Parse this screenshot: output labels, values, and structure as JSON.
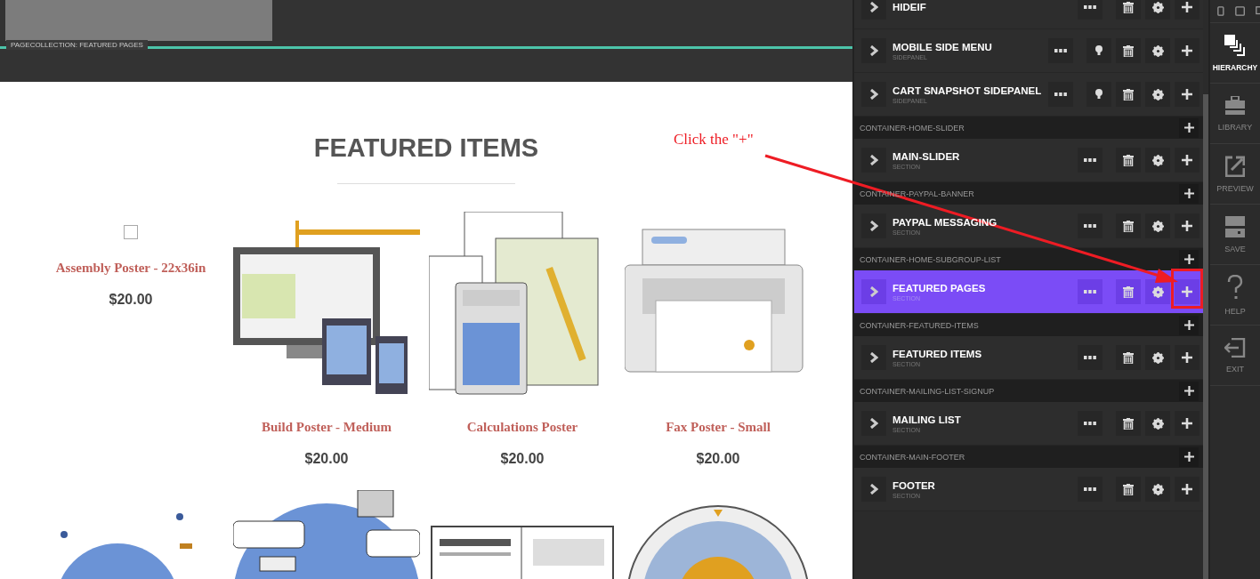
{
  "preview": {
    "collection_label": "PAGECOLLECTION: FEATURED PAGES",
    "heading": "FEATURED ITEMS",
    "products": [
      {
        "kind": "missing",
        "name": "Assembly Poster - 22x36in",
        "price": "$20.00"
      },
      {
        "kind": "construction",
        "name": "Build Poster - Medium",
        "price": "$20.00"
      },
      {
        "kind": "calculator",
        "name": "Calculations Poster",
        "price": "$20.00"
      },
      {
        "kind": "printer",
        "name": "Fax Poster - Small",
        "price": "$20.00"
      },
      {
        "kind": "globe"
      },
      {
        "kind": "map"
      },
      {
        "kind": "blueprint"
      },
      {
        "kind": "dial"
      }
    ]
  },
  "annotation": {
    "text": "Click the \"+\""
  },
  "hierarchy": {
    "entries": [
      {
        "kind": "item",
        "title": "HIDEIF",
        "lightbulb": false,
        "selected": false
      },
      {
        "kind": "item",
        "title": "MOBILE SIDE MENU",
        "subtitle": "SIDEPANEL",
        "lightbulb": true,
        "selected": false
      },
      {
        "kind": "item",
        "title": "CART SNAPSHOT SIDEPANEL",
        "subtitle": "SIDEPANEL",
        "lightbulb": true,
        "selected": false
      },
      {
        "kind": "container",
        "title": "CONTAINER-HOME-SLIDER"
      },
      {
        "kind": "item",
        "title": "MAIN-SLIDER",
        "subtitle": "SECTION",
        "lightbulb": false,
        "selected": false
      },
      {
        "kind": "container",
        "title": "CONTAINER-PAYPAL-BANNER"
      },
      {
        "kind": "item",
        "title": "PAYPAL MESSAGING",
        "subtitle": "SECTION",
        "lightbulb": false,
        "selected": false
      },
      {
        "kind": "container",
        "title": "CONTAINER-HOME-SUBGROUP-LIST"
      },
      {
        "kind": "item",
        "title": "FEATURED PAGES",
        "subtitle": "SECTION",
        "lightbulb": false,
        "selected": true
      },
      {
        "kind": "container",
        "title": "CONTAINER-FEATURED-ITEMS"
      },
      {
        "kind": "item",
        "title": "FEATURED ITEMS",
        "subtitle": "SECTION",
        "lightbulb": false,
        "selected": false
      },
      {
        "kind": "container",
        "title": "CONTAINER-MAILING-LIST-SIGNUP"
      },
      {
        "kind": "item",
        "title": "MAILING LIST",
        "subtitle": "SECTION",
        "lightbulb": false,
        "selected": false
      },
      {
        "kind": "container",
        "title": "CONTAINER-MAIN-FOOTER"
      },
      {
        "kind": "item",
        "title": "FOOTER",
        "subtitle": "SECTION",
        "lightbulb": false,
        "selected": false
      }
    ]
  },
  "rail": [
    {
      "label": "HIERARCHY",
      "selected": true
    },
    {
      "label": "LIBRARY",
      "selected": false
    },
    {
      "label": "PREVIEW",
      "selected": false
    },
    {
      "label": "SAVE",
      "selected": false
    },
    {
      "label": "HELP",
      "selected": false
    },
    {
      "label": "EXIT",
      "selected": false
    }
  ]
}
